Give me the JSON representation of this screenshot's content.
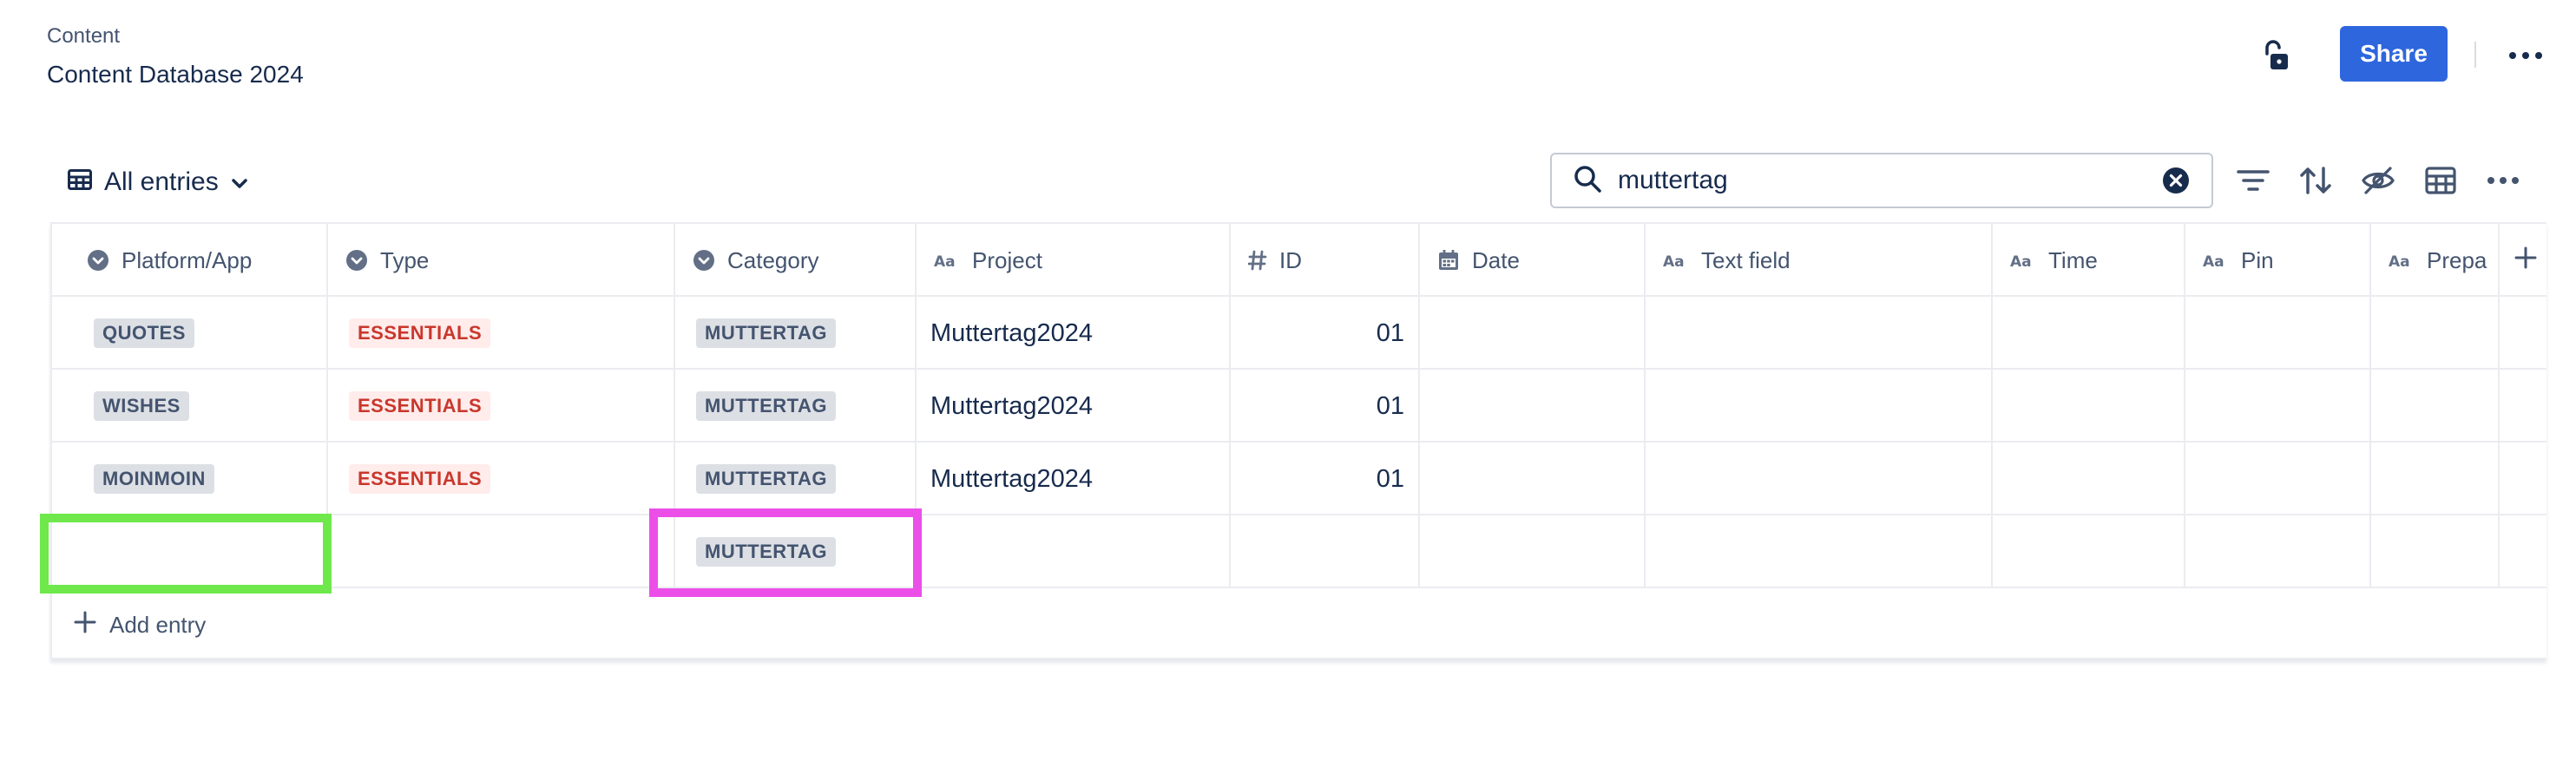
{
  "header": {
    "breadcrumb": "Content",
    "title": "Content Database 2024",
    "share_label": "Share",
    "lock_icon": "unlock-icon",
    "more_icon": "more-horizontal-icon"
  },
  "toolbar": {
    "view_label": "All entries",
    "search_value": "muttertag",
    "search_icon": "search-icon",
    "clear_icon": "clear-circle-icon",
    "icons": [
      "filter-icon",
      "sort-icon",
      "hide-fields-icon",
      "table-layout-icon",
      "more-horizontal-icon"
    ]
  },
  "table": {
    "columns": [
      {
        "label": "Platform/App",
        "icon": "select-icon"
      },
      {
        "label": "Type",
        "icon": "select-icon"
      },
      {
        "label": "Category",
        "icon": "select-icon"
      },
      {
        "label": "Project",
        "icon": "text-icon"
      },
      {
        "label": "ID",
        "icon": "number-icon"
      },
      {
        "label": "Date",
        "icon": "calendar-icon"
      },
      {
        "label": "Text field",
        "icon": "text-icon"
      },
      {
        "label": "Time",
        "icon": "text-icon"
      },
      {
        "label": "Pin",
        "icon": "text-icon"
      },
      {
        "label": "Prepa",
        "icon": "text-icon"
      }
    ],
    "rows": [
      {
        "platform": "QUOTES",
        "type": "ESSENTIALS",
        "category": "MUTTERTAG",
        "project": "Muttertag2024",
        "id": "01"
      },
      {
        "platform": "WISHES",
        "type": "ESSENTIALS",
        "category": "MUTTERTAG",
        "project": "Muttertag2024",
        "id": "01"
      },
      {
        "platform": "MOINMOIN",
        "type": "ESSENTIALS",
        "category": "MUTTERTAG",
        "project": "Muttertag2024",
        "id": "01"
      },
      {
        "platform": "",
        "type": "",
        "category": "MUTTERTAG",
        "project": "",
        "id": ""
      }
    ],
    "add_entry_label": "Add entry",
    "add_column_icon": "plus-icon"
  },
  "colors": {
    "accent": "#2e66de",
    "tag_gray_bg": "#dcdfe4",
    "tag_red_bg": "#ffeceb",
    "tag_red_text": "#c9372c",
    "highlight_green": "#6ee84b",
    "highlight_pink": "#ec4fe8"
  }
}
